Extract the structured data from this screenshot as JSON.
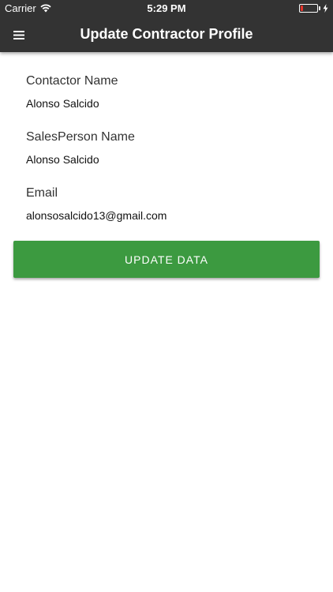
{
  "status_bar": {
    "carrier": "Carrier",
    "time": "5:29 PM",
    "battery_level": 0.15,
    "battery_color": "#e5332a"
  },
  "app_bar": {
    "title": "Update Contractor Profile",
    "menu_icon": "hamburger-menu-icon",
    "background_color": "#333333"
  },
  "form": {
    "contractor_label": "Contactor Name",
    "contractor_value": "Alonso Salcido",
    "salesperson_label": "SalesPerson Name",
    "salesperson_value": "Alonso Salcido",
    "email_label": "Email",
    "email_value": "alonsosalcido13@gmail.com"
  },
  "actions": {
    "update_label": "UPDATE DATA",
    "update_color": "#3c9a40"
  }
}
